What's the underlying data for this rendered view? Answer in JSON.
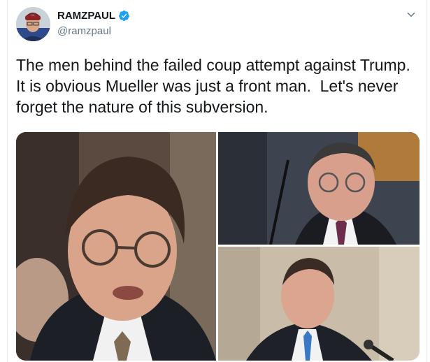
{
  "author": {
    "display_name": "RAMZPAUL",
    "handle": "@ramzpaul",
    "verified": true
  },
  "icons": {
    "verified": "verified-badge-icon",
    "menu": "chevron-down-icon"
  },
  "tweet": {
    "text": "The men behind the failed coup attempt against Trump.\nIt is obvious Mueller was just a front man.  Let's never\nforget the nature of this subversion."
  },
  "colors": {
    "verified_blue": "#1da1f2",
    "text": "#14171a",
    "secondary": "#657786"
  }
}
